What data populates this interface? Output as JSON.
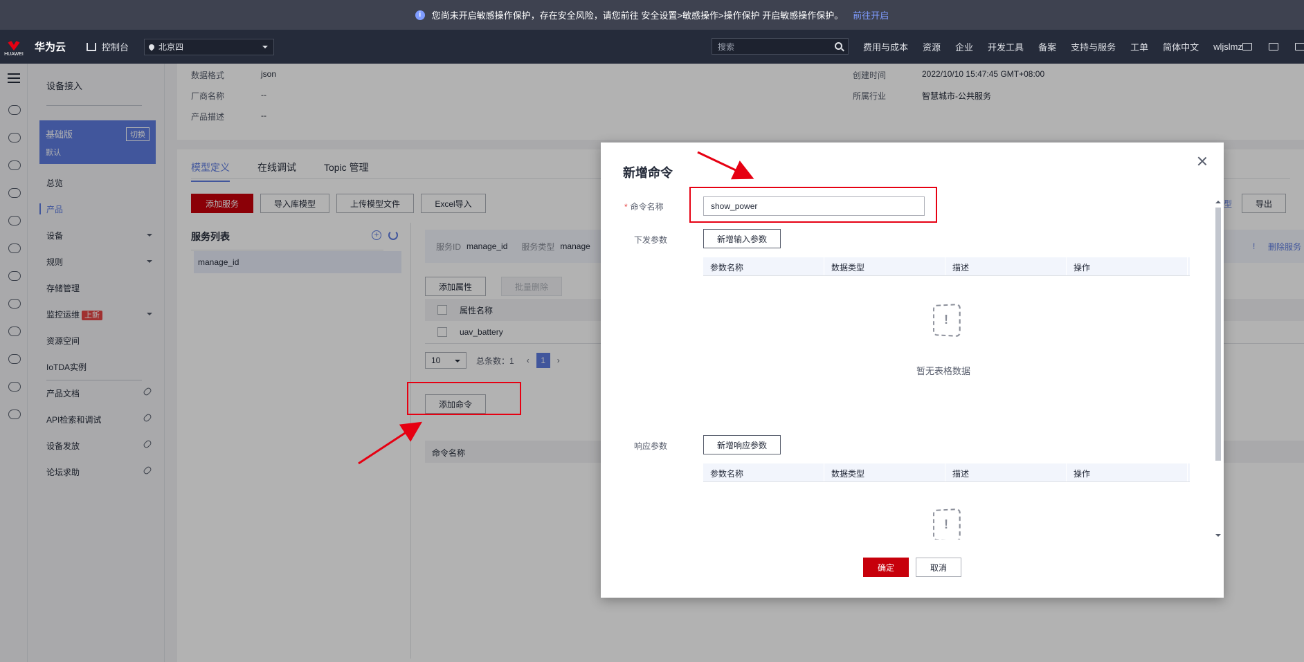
{
  "notice": {
    "text": "您尚未开启敏感操作保护，存在安全风险，请您前往 安全设置>敏感操作>操作保护 开启敏感操作保护。",
    "link": "前往开启"
  },
  "topnav": {
    "logo_text": "HUAWEI",
    "brand": "华为云",
    "console": "控制台",
    "region": "北京四",
    "search_placeholder": "搜索",
    "links": [
      "费用与成本",
      "资源",
      "企业",
      "开发工具",
      "备案",
      "支持与服务",
      "工单",
      "简体中文",
      "wljslmz"
    ]
  },
  "side": {
    "section_title": "设备接入",
    "plan_name": "基础版",
    "plan_switch": "切换",
    "plan_sub": "默认",
    "items": [
      "总览",
      "产品",
      "设备",
      "规则",
      "存储管理",
      "监控运维",
      "资源空间",
      "IoTDA实例"
    ],
    "monitor_badge": "上新",
    "links": [
      "产品文档",
      "API检索和调试",
      "设备发放",
      "论坛求助"
    ]
  },
  "info": {
    "data_format_label": "数据格式",
    "data_format_value": "json",
    "vendor_label": "厂商名称",
    "vendor_value": "--",
    "desc_label": "产品描述",
    "desc_value": "--",
    "created_label": "创建时间",
    "created_value": "2022/10/10 15:47:45 GMT+08:00",
    "industry_label": "所属行业",
    "industry_value": "智慧城市-公共服务"
  },
  "tabs": [
    "模型定义",
    "在线调试",
    "Topic 管理"
  ],
  "toolbar": {
    "add_service": "添加服务",
    "import_lib": "导入库模型",
    "upload_model": "上传模型文件",
    "excel_import": "Excel导入",
    "export": "导出",
    "model_partial": "型"
  },
  "service_list": {
    "title": "服务列表",
    "items": [
      "manage_id"
    ]
  },
  "service_info": {
    "id_label": "服务ID",
    "id_value": "manage_id",
    "type_label": "服务类型",
    "type_value": "manage",
    "delete": "删除服务",
    "bang": "!"
  },
  "properties": {
    "add": "添加属性",
    "batch_delete": "批量删除",
    "col_name": "属性名称",
    "rows": [
      "uav_battery"
    ]
  },
  "pager": {
    "size": "10",
    "total": "总条数：1",
    "current": "1"
  },
  "commands": {
    "add": "添加命令",
    "col_name": "命令名称"
  },
  "modal": {
    "title": "新增命令",
    "name_label": "命令名称",
    "name_value": "show_power",
    "send_label": "下发参数",
    "add_input": "新增输入参数",
    "response_label": "响应参数",
    "add_response": "新增响应参数",
    "columns": [
      "参数名称",
      "数据类型",
      "描述",
      "操作"
    ],
    "empty_text": "暂无表格数据",
    "confirm": "确定",
    "cancel": "取消"
  }
}
